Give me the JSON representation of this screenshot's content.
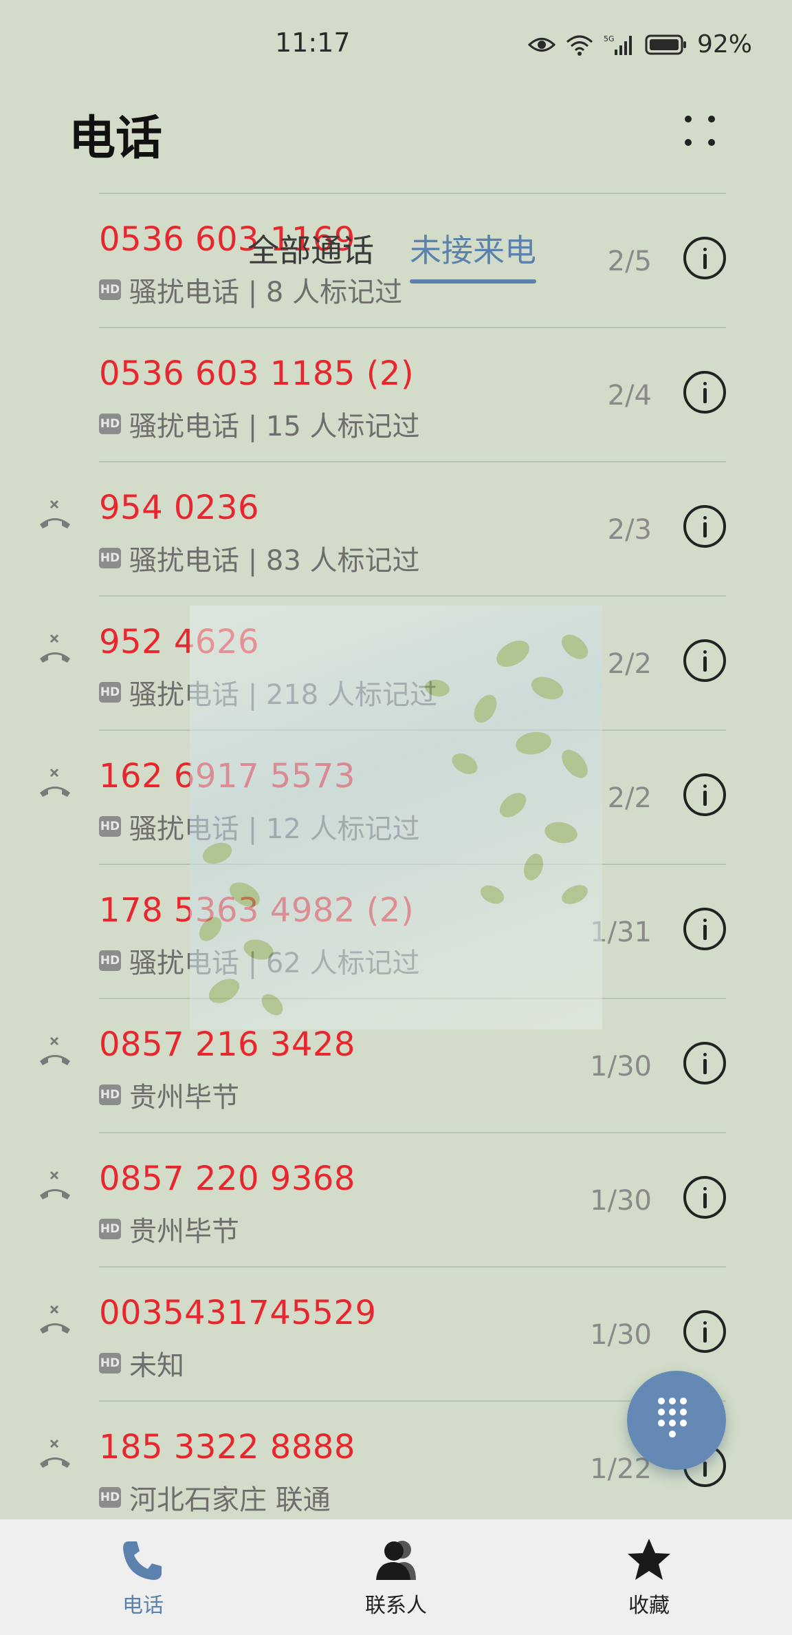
{
  "status_bar": {
    "time": "11:17",
    "battery": "92%"
  },
  "header": {
    "title": "电话"
  },
  "tabs": [
    {
      "label": "全部通话",
      "active": false
    },
    {
      "label": "未接来电",
      "active": true
    }
  ],
  "calls": [
    {
      "number": "0536 603 1169",
      "sub": "骚扰电话 | 8 人标记过",
      "date": "2/5",
      "missed_icon": false
    },
    {
      "number": "0536 603 1185 (2)",
      "sub": "骚扰电话 | 15 人标记过",
      "date": "2/4",
      "missed_icon": false
    },
    {
      "number": "954 0236",
      "sub": "骚扰电话 | 83 人标记过",
      "date": "2/3",
      "missed_icon": true
    },
    {
      "number": "952 4626",
      "sub": "骚扰电话 | 218 人标记过",
      "date": "2/2",
      "missed_icon": true
    },
    {
      "number": "162 6917 5573",
      "sub": "骚扰电话 | 12 人标记过",
      "date": "2/2",
      "missed_icon": true
    },
    {
      "number": "178 5363 4982 (2)",
      "sub": "骚扰电话 | 62 人标记过",
      "date": "1/31",
      "missed_icon": false
    },
    {
      "number": "0857 216 3428",
      "sub": "贵州毕节",
      "date": "1/30",
      "missed_icon": true
    },
    {
      "number": "0857 220 9368",
      "sub": "贵州毕节",
      "date": "1/30",
      "missed_icon": true
    },
    {
      "number": "0035431745529",
      "sub": "未知",
      "date": "1/30",
      "missed_icon": true
    },
    {
      "number": "185 3322 8888",
      "sub": "河北石家庄 联通",
      "date": "1/22",
      "missed_icon": true
    }
  ],
  "hd_badge": "HD",
  "bottom_nav": [
    {
      "label": "电话",
      "icon": "phone-icon",
      "active": true
    },
    {
      "label": "联系人",
      "icon": "contacts-icon",
      "active": false
    },
    {
      "label": "收藏",
      "icon": "star-icon",
      "active": false
    }
  ],
  "colors": {
    "accent": "#5b82ad",
    "missed": "#e8262d",
    "background": "#d2dcc8"
  }
}
